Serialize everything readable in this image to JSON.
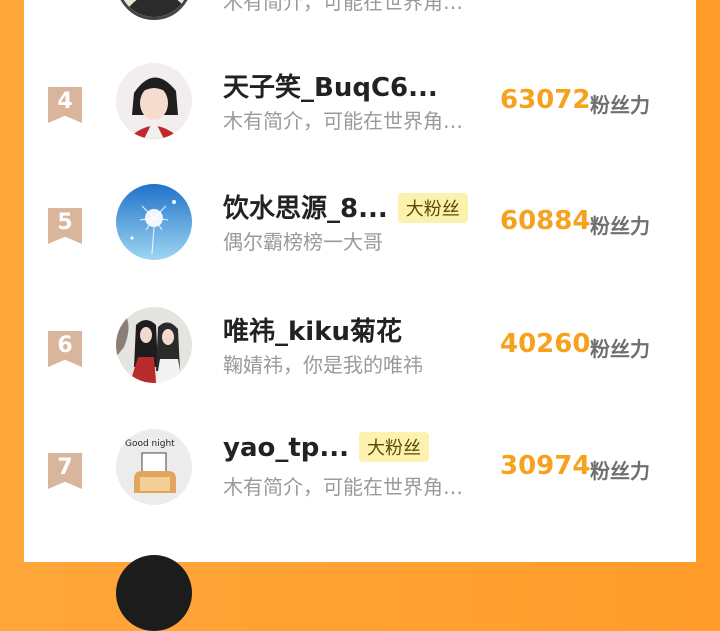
{
  "top_partial": {
    "desc": "木有简介，可能在世界角…"
  },
  "score_unit": "粉丝力",
  "badge_label": "大粉丝",
  "rows": [
    {
      "rank": "4",
      "name": "天子笑_BuqC6...",
      "desc": "木有简介，可能在世界角…",
      "score": "63072"
    },
    {
      "rank": "5",
      "name": "饮水思源_8...",
      "desc": "偶尔霸榜榜一大哥",
      "score": "60884",
      "badge": "大粉丝"
    },
    {
      "rank": "6",
      "name": "唯祎_kiku菊花",
      "desc": "鞠婧祎，你是我的唯祎",
      "score": "40260"
    },
    {
      "rank": "7",
      "name": "yao_tp...",
      "desc": "木有简介，可能在世界角…",
      "score": "30974",
      "badge": "大粉丝"
    }
  ],
  "avatars": {
    "row7_text": "Good night"
  },
  "colors": {
    "accent": "#f6a21e",
    "rank_ribbon": "#d8b59b",
    "badge_bg": "#fdf1b0",
    "frame": "#ff9c2a"
  }
}
